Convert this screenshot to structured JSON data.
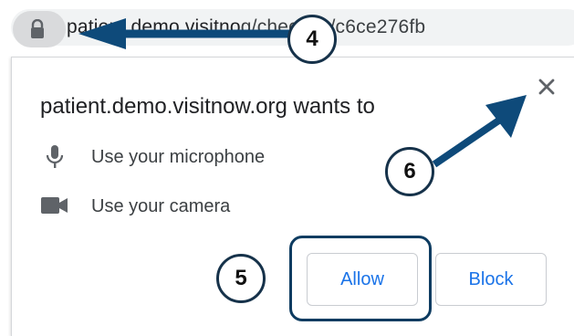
{
  "address_bar": {
    "url_host_visible": "pa",
    "url_fragment_middle": "tient.demo.visitno",
    "url_path": "g/check-in/c6ce276fb",
    "lock_icon": "lock-icon"
  },
  "permission_prompt": {
    "title": "patient.demo.visitnow.org wants to",
    "close_icon": "close-icon",
    "permissions": [
      {
        "icon": "microphone-icon",
        "label": "Use your microphone"
      },
      {
        "icon": "camera-icon",
        "label": "Use your camera"
      }
    ],
    "allow_label": "Allow",
    "block_label": "Block",
    "accent_color": "#1a73e8"
  },
  "callouts": {
    "lock": "4",
    "allow": "5",
    "close": "6",
    "arrow_color": "#0e4a7a"
  }
}
